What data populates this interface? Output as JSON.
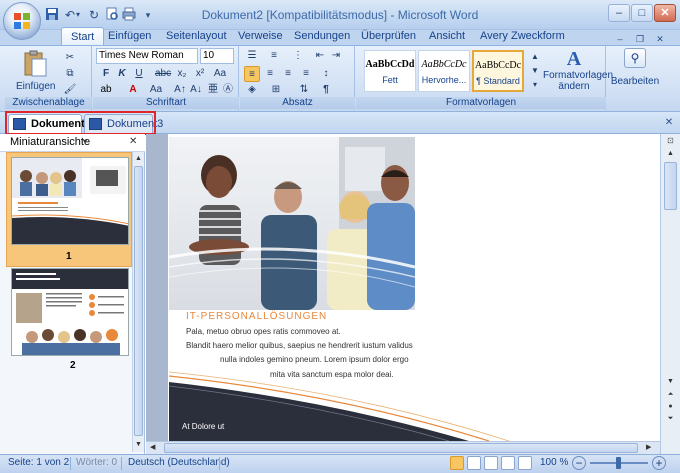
{
  "window": {
    "title": "Dokument2 [Kompatibilitätsmodus] - Microsoft Word",
    "min": "–",
    "max": "□",
    "close": "✕",
    "ribbon_min": "–",
    "ribbon_restore": "❐",
    "ribbon_close": "✕"
  },
  "ribbon_tabs": [
    "Start",
    "Einfügen",
    "Seitenlayout",
    "Verweise",
    "Sendungen",
    "Überprüfen",
    "Ansicht",
    "Avery Zweckform"
  ],
  "groups": {
    "clipboard": "Zwischenablage",
    "paste": "Einfügen",
    "font": "Schriftart",
    "font_name": "Times New Roman",
    "font_size": "10",
    "paragraph": "Absatz",
    "styles": "Formatvorlagen",
    "change_styles_line1": "Formatvorlagen",
    "change_styles_line2": "ändern",
    "editing": "Bearbeiten"
  },
  "styles": [
    {
      "sample": "AaBbCcDd",
      "name": "Fett"
    },
    {
      "sample": "AaBbCcDc",
      "name": "Hervorhe..."
    },
    {
      "sample": "AaBbCcDc",
      "name": "¶ Standard"
    }
  ],
  "doc_tabs": [
    "Dokument2",
    "Dokument3"
  ],
  "doc_tabbar_close": "✕",
  "thumbnail_pane": {
    "title": "Miniaturansichte",
    "close": "✕",
    "pages": [
      "1",
      "2"
    ]
  },
  "document": {
    "heading": "IT-PERSONALLÖSUNGEN",
    "lines": [
      "Pala, metuo obruo opes ratis commoveo at.",
      "Blandit haero melior quibus, saepius ne hendrerit iustum validus",
      "nulla indoles gemino pneum. Lorem ipsum dolor ergo",
      "mita vita sanctum espa molor deai."
    ],
    "footer_text": "At Dolore ut"
  },
  "status": {
    "page": "Seite: 1 von 2",
    "words": "Wörter: 0",
    "language": "Deutsch (Deutschland)",
    "zoom": "100 %"
  },
  "colors": {
    "accent_orange": "#e8883a",
    "dark_band": "#2b2f3b",
    "highlight_red": "#e0252b"
  }
}
